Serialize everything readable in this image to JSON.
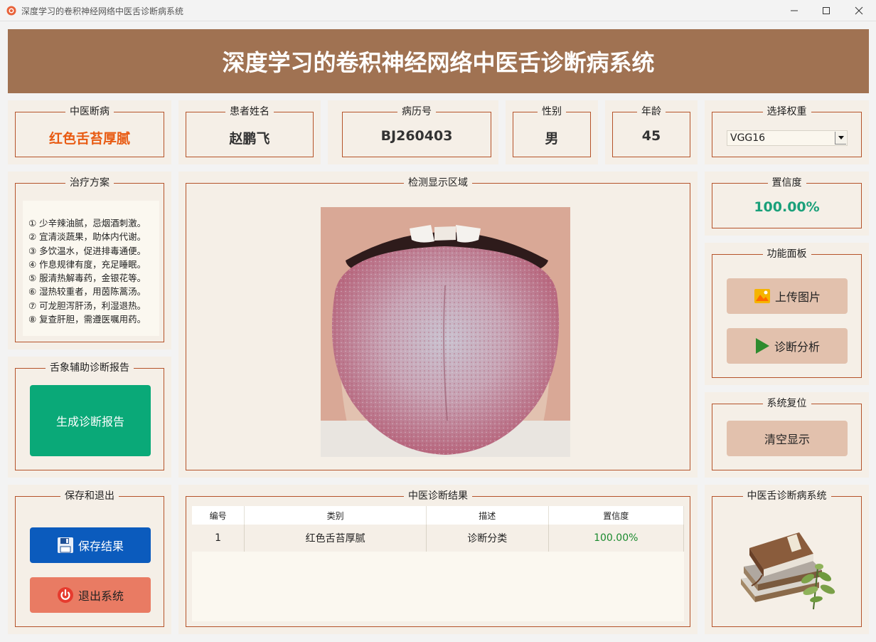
{
  "window": {
    "title": "深度学习的卷积神经网络中医舌诊断病系统"
  },
  "header": {
    "title": "深度学习的卷积神经网络中医舌诊断病系统"
  },
  "info": {
    "diagnosis": {
      "label": "中医断病",
      "value": "红色舌苔厚腻"
    },
    "patient_name": {
      "label": "患者姓名",
      "value": "赵鹏飞"
    },
    "record_no": {
      "label": "病历号",
      "value": "BJ260403"
    },
    "gender": {
      "label": "性别",
      "value": "男"
    },
    "age": {
      "label": "年龄",
      "value": "45"
    },
    "weights": {
      "label": "选择权重",
      "selected": "VGG16"
    }
  },
  "treatment": {
    "label": "治疗方案",
    "lines": [
      "① 少辛辣油腻，忌烟酒刺激。",
      "② 宜清淡蔬果，助体内代谢。",
      "③ 多饮温水，促进排毒通便。",
      "④ 作息规律有度，充足睡眠。",
      "⑤ 服清热解毒药，金银花等。",
      "⑥ 湿热较重者，用茵陈蒿汤。",
      "⑦ 可龙胆泻肝汤，利湿退热。",
      "⑧ 复查肝胆，需遵医嘱用药。"
    ]
  },
  "report": {
    "label": "舌象辅助诊断报告",
    "button": "生成诊断报告"
  },
  "save_exit": {
    "label": "保存和退出",
    "save_button": "保存结果",
    "exit_button": "退出系统"
  },
  "detection": {
    "label": "检测显示区域"
  },
  "results": {
    "label": "中医诊断结果",
    "columns": [
      "编号",
      "类别",
      "描述",
      "置信度"
    ],
    "rows": [
      {
        "id": "1",
        "category": "红色舌苔厚腻",
        "description": "诊断分类",
        "confidence": "100.00%"
      }
    ]
  },
  "confidence": {
    "label": "置信度",
    "value": "100.00%"
  },
  "functions": {
    "label": "功能面板",
    "upload_button": "上传图片",
    "analyze_button": "诊断分析"
  },
  "reset": {
    "label": "系统复位",
    "clear_button": "清空显示"
  },
  "brand": {
    "label": "中医舌诊断病系统"
  },
  "colors": {
    "banner": "#a07252",
    "panel": "#f5efe7",
    "border": "#b5532a",
    "diagnosis_text": "#e85a12",
    "confidence_text": "#1aa07a",
    "report_button": "#0aa978",
    "save_button": "#0b5bbd",
    "exit_button": "#e97b63",
    "action_button": "#e2c1ad"
  }
}
